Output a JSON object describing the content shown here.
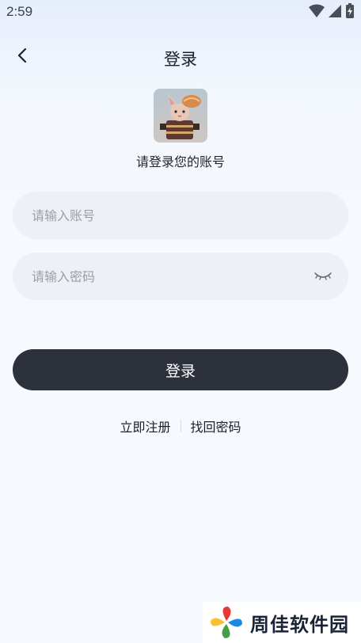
{
  "status_bar": {
    "time": "2:59",
    "icons": [
      "wifi-icon",
      "signal-icon",
      "battery-charging-icon"
    ]
  },
  "nav": {
    "back_icon": "chevron-left-icon",
    "title": "登录"
  },
  "profile": {
    "avatar": "cat-avatar-image",
    "subtitle": "请登录您的账号"
  },
  "form": {
    "account_placeholder": "请输入账号",
    "account_value": "",
    "password_placeholder": "请输入密码",
    "password_value": "",
    "password_toggle_icon": "eye-closed-icon",
    "submit_label": "登录"
  },
  "links": {
    "register": "立即注册",
    "recover": "找回密码"
  },
  "watermark": {
    "text": "周佳软件园"
  },
  "colors": {
    "primary_button": "#2c313c",
    "input_bg": "#eef0f5",
    "page_bg": "#f6f9fe"
  }
}
